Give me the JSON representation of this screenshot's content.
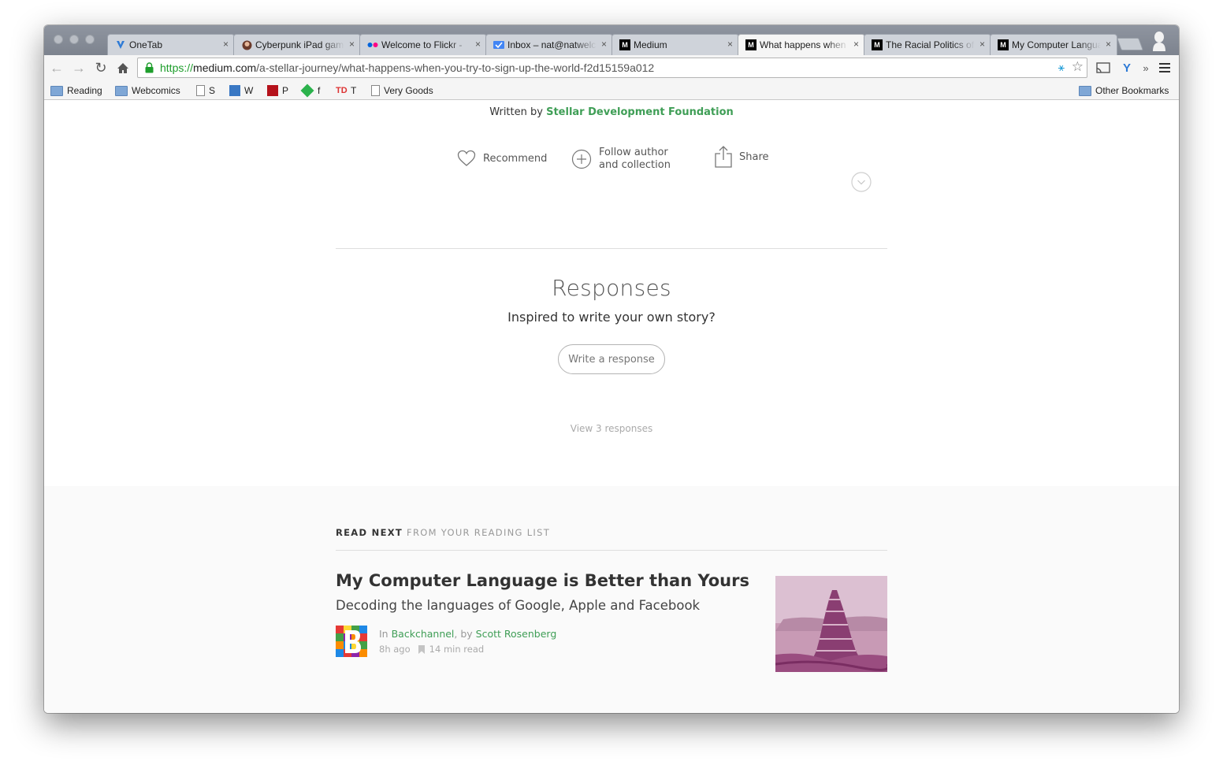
{
  "browser": {
    "tabs": [
      {
        "title": "OneTab",
        "favicon": "onetab-icon",
        "active": false
      },
      {
        "title": "Cyberpunk iPad game",
        "favicon": "avatar-icon",
        "active": false
      },
      {
        "title": "Welcome to Flickr - ",
        "favicon": "flickr-icon",
        "active": false
      },
      {
        "title": "Inbox – nat@natwelch",
        "favicon": "inbox-icon",
        "active": false
      },
      {
        "title": "Medium",
        "favicon": "medium-icon",
        "active": false
      },
      {
        "title": "What happens when you try",
        "favicon": "medium-icon",
        "active": true
      },
      {
        "title": "The Racial Politics of",
        "favicon": "medium-icon",
        "active": false
      },
      {
        "title": "My Computer Language",
        "favicon": "medium-icon",
        "active": false
      }
    ],
    "url": {
      "scheme": "https://",
      "host": "medium.com",
      "path": "/a-stellar-journey/what-happens-when-you-try-to-sign-up-the-world-f2d15159a012"
    },
    "bookmarks": [
      {
        "label": "Reading",
        "icon": "folder-icon"
      },
      {
        "label": "Webcomics",
        "icon": "folder-icon"
      },
      {
        "label": "S",
        "icon": "page-icon"
      },
      {
        "label": "W",
        "icon": "w-icon"
      },
      {
        "label": "P",
        "icon": "pinboard-icon"
      },
      {
        "label": "f",
        "icon": "feedly-icon"
      },
      {
        "label": "T",
        "icon": "tumblr-icon"
      },
      {
        "label": "Very Goods",
        "icon": "page-icon"
      }
    ],
    "other_bookmarks": "Other Bookmarks",
    "colors": {
      "https": "#1e9e2c",
      "accent": "#3f9e56"
    }
  },
  "article": {
    "written_by_prefix": "Written by",
    "author": "Stellar Development Foundation",
    "actions": {
      "recommend": "Recommend",
      "follow_line1": "Follow author",
      "follow_line2": "and collection",
      "share": "Share"
    }
  },
  "responses": {
    "title": "Responses",
    "prompt": "Inspired to write your own story?",
    "write_button": "Write a response",
    "view_link": "View 3 responses"
  },
  "read_next": {
    "header_bold": "READ NEXT",
    "header_rest": "FROM YOUR READING LIST",
    "title": "My Computer Language is Better than Yours",
    "subtitle": "Decoding the languages of Google, Apple and Facebook",
    "in_prefix": "In",
    "collection": "Backchannel",
    "by_prefix": ", by",
    "author": "Scott Rosenberg",
    "time_ago": "8h ago",
    "read_time": "14 min read"
  }
}
